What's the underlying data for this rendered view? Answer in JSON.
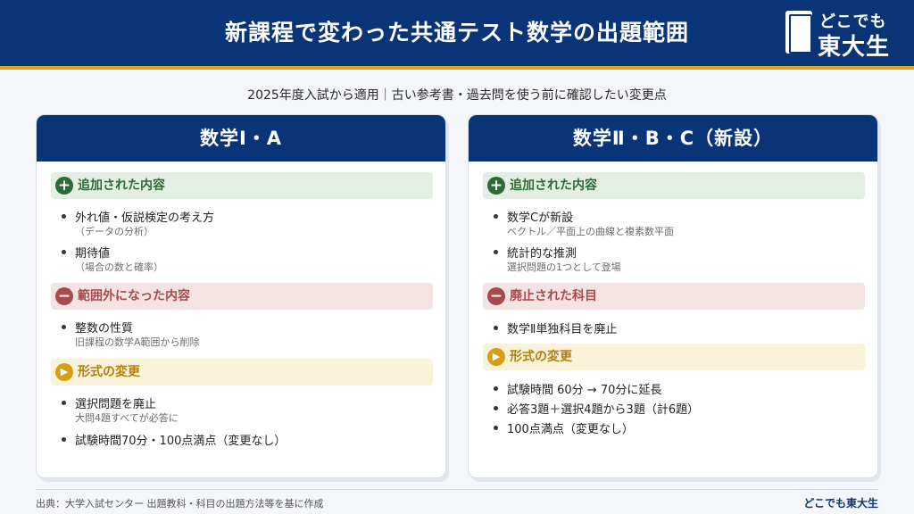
{
  "header": {
    "title": "新課程で変わった共通テスト数学の出題範囲",
    "logo_top": "どこでも",
    "logo_main": "東大生"
  },
  "subtitle": "2025年度入試から適用｜古い参考書・過去問を使う前に確認したい変更点",
  "left": {
    "title": "数学Ⅰ・A",
    "sec1": {
      "label": "追加された内容",
      "icon": "+"
    },
    "sec1_items": [
      {
        "main": "外れ値・仮説検定の考え方",
        "note": "（データの分析）"
      },
      {
        "main": "期待値",
        "note": "（場合の数と確率）"
      }
    ],
    "sec2": {
      "label": "範囲外になった内容",
      "icon": "−"
    },
    "sec2_items": [
      {
        "main": "整数の性質",
        "note": "旧課程の数学A範囲から削除"
      }
    ],
    "sec3": {
      "label": "形式の変更",
      "icon": "▶"
    },
    "sec3_items": [
      {
        "main": "選択問題を廃止",
        "note": "大問4題すべてが必答に"
      },
      {
        "main": "試験時間70分・100点満点（変更なし）"
      }
    ]
  },
  "right": {
    "title": "数学Ⅱ・B・C（新設）",
    "sec1": {
      "label": "追加された内容",
      "icon": "+"
    },
    "sec1_items": [
      {
        "main": "数学Cが新設",
        "note": "ベクトル／平面上の曲線と複素数平面"
      },
      {
        "main": "統計的な推測",
        "note": "選択問題の1つとして登場"
      }
    ],
    "sec2": {
      "label": "廃止された科目",
      "icon": "−"
    },
    "sec2_items": [
      {
        "main": "数学Ⅱ単独科目を廃止"
      }
    ],
    "sec3": {
      "label": "形式の変更",
      "icon": "▶"
    },
    "sec3_items": [
      {
        "main": "試験時間 60分 → 70分に延長"
      },
      {
        "main": "必答3題＋選択4題から3題（計6題）"
      },
      {
        "main": "100点満点（変更なし）"
      }
    ]
  },
  "footer": {
    "source": "出典：大学入試センター 出題教科・科目の出題方法等を基に作成",
    "brand": "どこでも東大生"
  },
  "colors": {
    "navy": "#0a3478",
    "gold": "#d9a41f",
    "added": "#2d6b36",
    "removed": "#a84a4a",
    "format": "#d69e14"
  }
}
